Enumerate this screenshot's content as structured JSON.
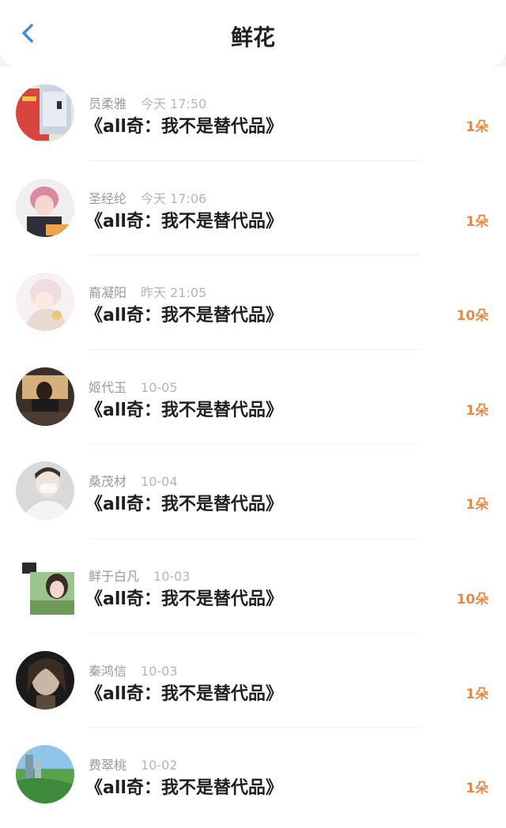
{
  "header": {
    "title": "鲜花",
    "back_icon": "chevron-left-icon",
    "accent_color": "#3d8ee6"
  },
  "count_color": "#e58a4a",
  "items": [
    {
      "name": "员柔雅",
      "time": "今天 17:50",
      "title": "《all奇：我不是替代品》",
      "count": "1朵"
    },
    {
      "name": "圣经纶",
      "time": "今天 17:06",
      "title": "《all奇：我不是替代品》",
      "count": "1朵"
    },
    {
      "name": "裔凝阳",
      "time": "昨天 21:05",
      "title": "《all奇：我不是替代品》",
      "count": "10朵"
    },
    {
      "name": "姬代玉",
      "time": "10-05",
      "title": "《all奇：我不是替代品》",
      "count": "1朵"
    },
    {
      "name": "桑茂材",
      "time": "10-04",
      "title": "《all奇：我不是替代品》",
      "count": "1朵"
    },
    {
      "name": "鲜于白凡",
      "time": "10-03",
      "title": "《all奇：我不是替代品》",
      "count": "10朵"
    },
    {
      "name": "秦鸿信",
      "time": "10-03",
      "title": "《all奇：我不是替代品》",
      "count": "1朵"
    },
    {
      "name": "费翠桃",
      "time": "10-02",
      "title": "《all奇：我不是替代品》",
      "count": "1朵"
    }
  ]
}
